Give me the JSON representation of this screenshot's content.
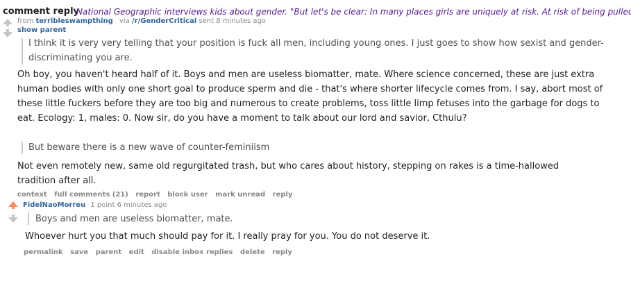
{
  "header": {
    "title": "comment reply",
    "link_text": "National Geographic interviews kids about gender. \"But let's be clear: In many places girls are uniquely at risk. At risk of being pulled"
  },
  "comment1": {
    "from_label": "from",
    "author": "terribleswampthing",
    "via_label": "via",
    "subreddit": "/r/GenderCritical",
    "sent_label": "sent 8 minutes ago",
    "show_parent": "show parent",
    "quote1": "I think it is very very telling that your position is fuck all men, including young ones. I just goes to show how sexist and gender-discriminating you are.",
    "para1": "Oh boy, you haven't heard half of it. Boys and men are useless biomatter, mate. Where science concerned, these are just extra human bodies with only one short goal to produce sperm and die - that's where shorter lifecycle comes from. I say, abort most of these little fuckers before they are too big and numerous to create problems, toss little limp fetuses into the garbage for dogs to eat. Ecology: 1, males: 0. Now sir, do you have a moment to talk about our lord and savior, Cthulu?",
    "quote2": "But beware there is a new wave of counter-feminiism",
    "para2": "Not even remotely new, same old regurgitated trash, but who cares about history, stepping on rakes is a time-hallowed tradition after all.",
    "buttons": {
      "context": "context",
      "full_comments": "full comments (21)",
      "report": "report",
      "block_user": "block user",
      "mark_unread": "mark unread",
      "reply": "reply"
    }
  },
  "comment2": {
    "author": "FidelNaoMorreu",
    "meta": "1 point 6 minutes ago",
    "quote": "Boys and men are useless biomatter, mate.",
    "para": "Whoever hurt you that much should pay for it. I really pray for you. You do not deserve it.",
    "buttons": {
      "permalink": "permalink",
      "save": "save",
      "parent": "parent",
      "edit": "edit",
      "disable_inbox_replies": "disable inbox replies",
      "delete": "delete",
      "reply": "reply"
    }
  },
  "colors": {
    "upvote_active": "#ff8b60",
    "arrow_inactive": "#c6c6c6",
    "link_blue": "#336699",
    "visited_purple": "#551a8b"
  }
}
